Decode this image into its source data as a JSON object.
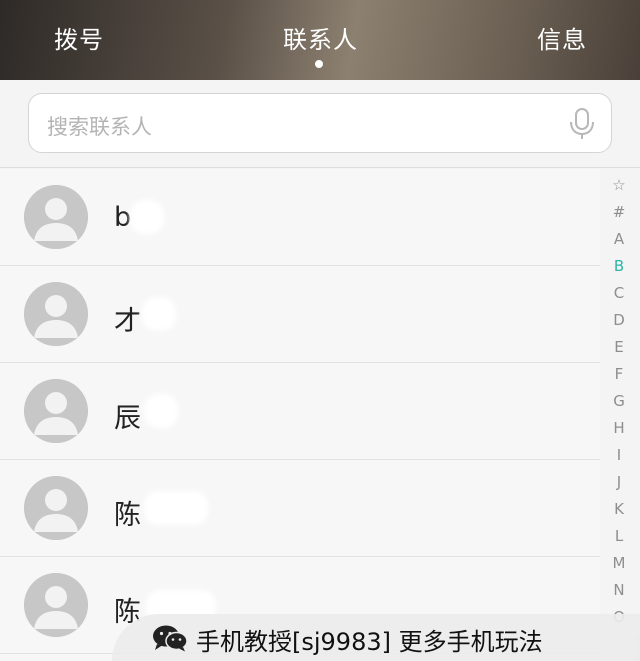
{
  "header": {
    "tabs": [
      {
        "label": "拨号"
      },
      {
        "label": "联系人",
        "active": true
      },
      {
        "label": "信息"
      }
    ]
  },
  "search": {
    "placeholder": "搜索联系人",
    "icon": "microphone-icon"
  },
  "contacts": [
    {
      "name_visible": "b"
    },
    {
      "name_visible": "才"
    },
    {
      "name_visible": "辰"
    },
    {
      "name_visible": "陈"
    },
    {
      "name_visible": "陈"
    }
  ],
  "alphabet_index": {
    "letters": [
      "☆",
      "#",
      "A",
      "B",
      "C",
      "D",
      "E",
      "F",
      "G",
      "H",
      "I",
      "J",
      "K",
      "L",
      "M",
      "N",
      "O"
    ],
    "active": "B",
    "active_color": "#2fb3a8"
  },
  "watermark": {
    "icon": "wechat-icon",
    "text": "手机教授[sj9983] 更多手机玩法"
  }
}
